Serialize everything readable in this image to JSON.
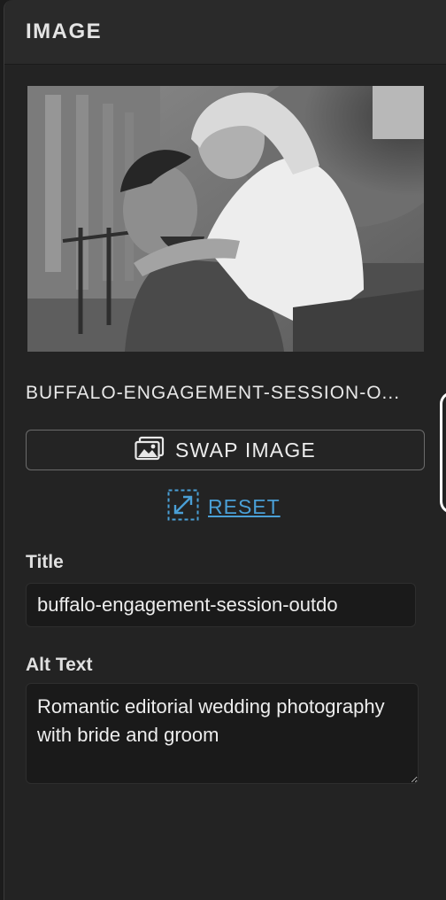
{
  "panel": {
    "title": "IMAGE"
  },
  "image": {
    "filename": "BUFFALO-ENGAGEMENT-SESSION-O...",
    "preview_description": "photo-preview"
  },
  "actions": {
    "swap_label": "SWAP IMAGE",
    "reset_label": "RESET"
  },
  "fields": {
    "title_label": "Title",
    "title_value": "buffalo-engagement-session-outdo",
    "alt_label": "Alt Text",
    "alt_value": "Romantic editorial wedding photography with bride and groom"
  },
  "icons": {
    "swap": "image-icon",
    "reset": "expand-icon"
  },
  "colors": {
    "accent": "#4a9fd6",
    "panel_bg": "#232323",
    "header_bg": "#2a2a2a",
    "input_bg": "#1a1a1a"
  }
}
